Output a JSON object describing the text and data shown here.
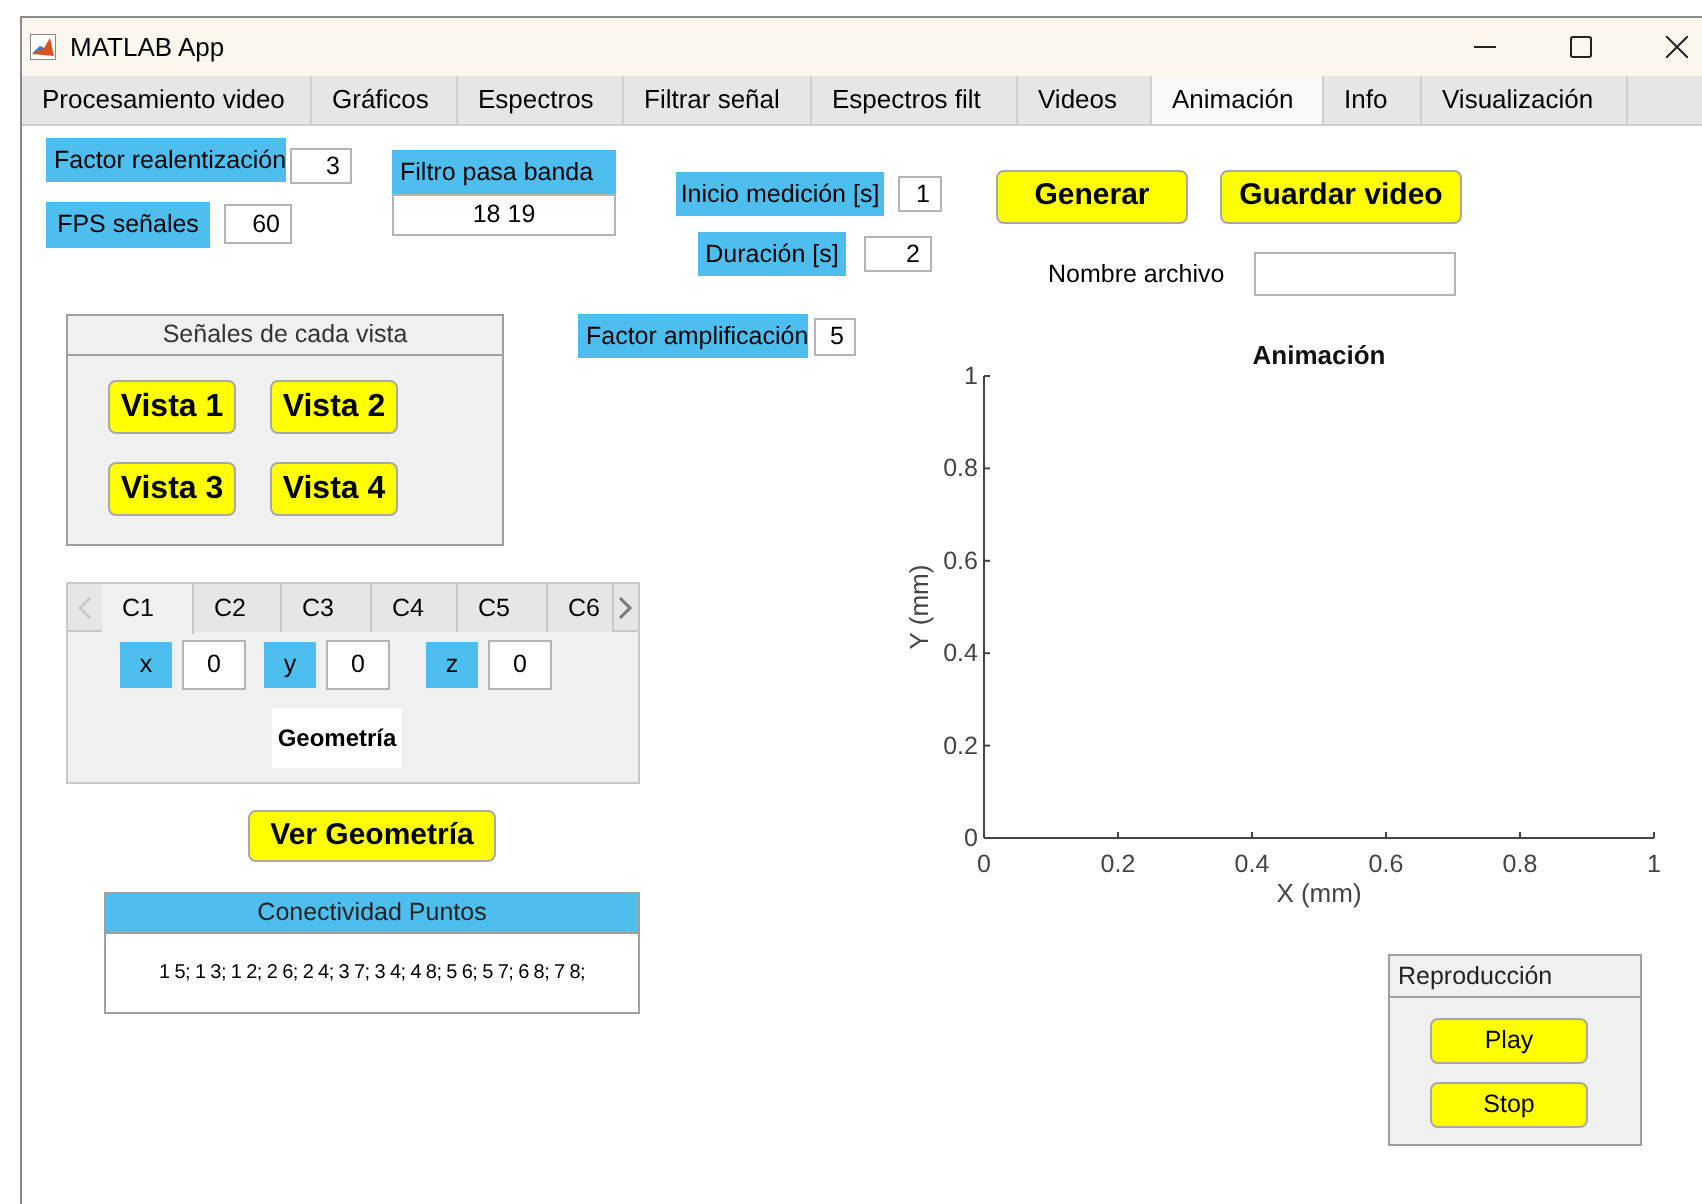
{
  "window": {
    "title": "MATLAB App"
  },
  "tabs": [
    {
      "label": "Procesamiento video",
      "selected": false
    },
    {
      "label": "Gráficos",
      "selected": false
    },
    {
      "label": "Espectros",
      "selected": false
    },
    {
      "label": "Filtrar señal",
      "selected": false
    },
    {
      "label": "Espectros filt",
      "selected": false
    },
    {
      "label": "Videos",
      "selected": false
    },
    {
      "label": "Animación",
      "selected": true
    },
    {
      "label": "Info",
      "selected": false
    },
    {
      "label": "Visualización",
      "selected": false
    }
  ],
  "slowdown_factor": {
    "label": "Factor realentización",
    "value": "3"
  },
  "signal_fps": {
    "label": "FPS señales",
    "value": "60"
  },
  "bandpass_filter": {
    "label": "Filtro pasa banda",
    "value": "18 19"
  },
  "measure_start": {
    "label": "Inicio medición [s]",
    "value": "1"
  },
  "duration": {
    "label": "Duración [s]",
    "value": "2"
  },
  "actions": [
    "Generar",
    "Guardar video"
  ],
  "file_name": {
    "label": "Nombre archivo"
  },
  "views_panel": {
    "title": "Señales de cada vista",
    "buttons": [
      "Vista 1",
      "Vista 2",
      "Vista 3",
      "Vista 4"
    ]
  },
  "amplification": {
    "label": "Factor amplificación",
    "value": "5"
  },
  "component_tabs": {
    "tabs": [
      {
        "label": "C1",
        "selected": true
      },
      {
        "label": "C2",
        "selected": false
      },
      {
        "label": "C3",
        "selected": false
      },
      {
        "label": "C4",
        "selected": false
      },
      {
        "label": "C5",
        "selected": false
      },
      {
        "label": "C6",
        "selected": false
      }
    ],
    "coords": [
      {
        "label": "x",
        "value": "0"
      },
      {
        "label": "y",
        "value": "0"
      },
      {
        "label": "z",
        "value": "0"
      }
    ],
    "geometry_label": "Geometría"
  },
  "geometry_button": "Ver Geometría",
  "connectivity": {
    "title": "Conectividad Puntos",
    "text": "1 5; 1 3; 1 2; 2 6; 2 4; 3 7; 3 4; 4 8; 5 6; 5 7; 6 8; 7 8;"
  },
  "chart": {
    "chart_data": {
      "type": "line",
      "title": "Animación",
      "xlabel": "X (mm)",
      "ylabel": "Y (mm)",
      "xlim": [
        0,
        1
      ],
      "ylim": [
        0,
        1
      ],
      "xticks": [
        0,
        0.2,
        0.4,
        0.6,
        0.8,
        1
      ],
      "yticks": [
        0,
        0.2,
        0.4,
        0.6,
        0.8,
        1
      ]
    }
  },
  "playback": {
    "title": "Reproducción",
    "buttons": [
      "Play",
      "Stop"
    ]
  }
}
